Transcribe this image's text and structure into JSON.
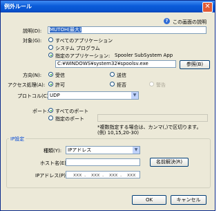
{
  "window": {
    "title": "例外ルール",
    "close": "✕"
  },
  "help_link": {
    "label": "この画面の説明",
    "icon": "?"
  },
  "description": {
    "label": "説明(D):",
    "value": "MUTOH(最大)"
  },
  "target": {
    "label": "対象(G):",
    "options": [
      "すべてのアプリケーション",
      "システム プログラム",
      "指定のアプリケーション:"
    ],
    "selected": 2,
    "app_name": "Spooler SubSystem App",
    "path": "C:¥WINDOWS¥system32¥spoolsv.exe",
    "browse_label": "参照(B)"
  },
  "direction": {
    "label": "方向(N):",
    "options": [
      "受信",
      "送信"
    ],
    "selected": 0
  },
  "access": {
    "label": "アクセス処理(A):",
    "options": [
      "許可",
      "拒否",
      "警告"
    ],
    "selected": 0
  },
  "protocol": {
    "label": "プロトコル(C):",
    "value": "UDP"
  },
  "port": {
    "label": "ポート:",
    "options": [
      "すべてのポート",
      "指定のポート"
    ],
    "selected": 0,
    "note_line1": "*複数指定する場合は、カンマ(,)で区切ります。",
    "note_line2": "(例) 10,15,20-30)"
  },
  "ip_group": {
    "title": "IP設定",
    "type_label": "種類(Y):",
    "type_value": "IPアドレス",
    "host_label": "ホスト名(E):",
    "resolve_label": "名前解決(R)",
    "ip_label": "IPアドレス(P):",
    "ip_octets": [
      "xxx",
      "xxx",
      "xxx",
      "xxx"
    ],
    "ip_dot": "."
  },
  "footer": {
    "ok_label": "OK",
    "cancel_label": "キャンセル"
  }
}
